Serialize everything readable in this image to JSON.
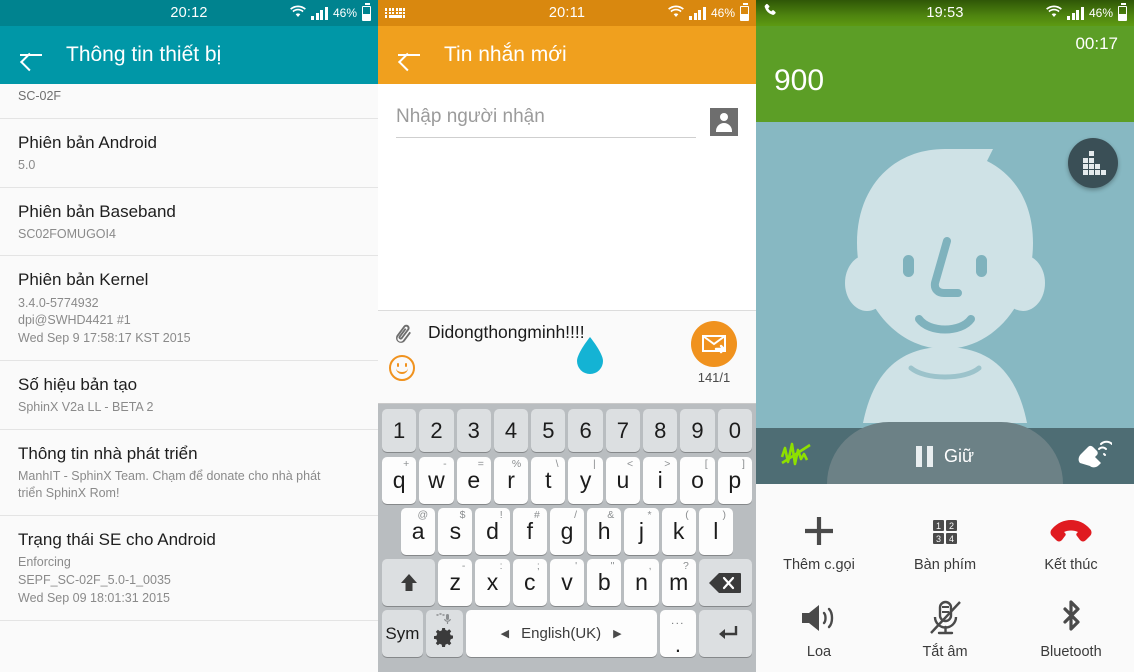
{
  "panel1": {
    "statusbar": {
      "time": "20:12",
      "battery_text": "46%",
      "wifi_icon": "wifi-icon",
      "signal_icon": "signal-bars-icon",
      "battery_icon": "battery-icon"
    },
    "appbar": {
      "back_icon": "back-arrow-icon",
      "title": "Thông tin thiết bị",
      "accent": "#0097a7"
    },
    "partial_row": {
      "value": "SC-02F"
    },
    "rows": [
      {
        "title": "Phiên bản Android",
        "sub": "5.0"
      },
      {
        "title": "Phiên bản Baseband",
        "sub": "SC02FOMUGOI4"
      },
      {
        "title": "Phiên bản Kernel",
        "sub": "3.4.0-5774932\ndpi@SWHD4421 #1\nWed Sep 9 17:58:17 KST 2015"
      },
      {
        "title": "Số hiệu bản tạo",
        "sub": "SphinX V2a LL - BETA 2"
      },
      {
        "title": "Thông tin nhà phát triển",
        "sub": "ManhIT - SphinX Team. Chạm để donate cho nhà phát\ntriển SphinX Rom!"
      },
      {
        "title": "Trạng thái SE cho Android",
        "sub": "Enforcing\nSEPF_SC-02F_5.0-1_0035\nWed Sep 09 18:01:31 2015"
      }
    ]
  },
  "panel2": {
    "statusbar": {
      "time": "20:11",
      "battery_text": "46%",
      "left_icon": "keyboard-icon"
    },
    "appbar": {
      "back_icon": "back-arrow-icon",
      "title": "Tin nhắn mới",
      "accent": "#f0a01e"
    },
    "recipient": {
      "placeholder": "Nhập người nhận",
      "value": "",
      "contact_icon": "contact-picker-icon"
    },
    "composer": {
      "attach_icon": "paperclip-icon",
      "message": "Didongthongminh!!!!",
      "emoji_icon": "smiley-icon",
      "sticker_icon": "water-drop-icon",
      "send_icon": "send-mms-icon",
      "counter": "141/1"
    },
    "keyboard": {
      "numbers": [
        "1",
        "2",
        "3",
        "4",
        "5",
        "6",
        "7",
        "8",
        "9",
        "0"
      ],
      "row1": [
        {
          "key": "q",
          "alt": "+"
        },
        {
          "key": "w",
          "alt": "-"
        },
        {
          "key": "e",
          "alt": "="
        },
        {
          "key": "r",
          "alt": "%"
        },
        {
          "key": "t",
          "alt": "\\"
        },
        {
          "key": "y",
          "alt": "|"
        },
        {
          "key": "u",
          "alt": "<"
        },
        {
          "key": "i",
          "alt": ">"
        },
        {
          "key": "o",
          "alt": "["
        },
        {
          "key": "p",
          "alt": "]"
        }
      ],
      "row2": [
        {
          "key": "a",
          "alt": "@"
        },
        {
          "key": "s",
          "alt": "$"
        },
        {
          "key": "d",
          "alt": "!"
        },
        {
          "key": "f",
          "alt": "#"
        },
        {
          "key": "g",
          "alt": "/"
        },
        {
          "key": "h",
          "alt": "&"
        },
        {
          "key": "j",
          "alt": "*"
        },
        {
          "key": "k",
          "alt": "("
        },
        {
          "key": "l",
          "alt": ")"
        }
      ],
      "row3": [
        {
          "key": "z",
          "alt": "-"
        },
        {
          "key": "x",
          "alt": ":"
        },
        {
          "key": "c",
          "alt": ";"
        },
        {
          "key": "v",
          "alt": "'"
        },
        {
          "key": "b",
          "alt": "\""
        },
        {
          "key": "n",
          "alt": ","
        },
        {
          "key": "m",
          "alt": "?"
        }
      ],
      "shift_icon": "shift-arrow-icon",
      "delete_icon": "backspace-icon",
      "sym_label": "Sym",
      "settings_icon": "gear-mic-icon",
      "space_label": "English(UK)",
      "space_prev_icon": "prev-language-icon",
      "space_next_icon": "next-language-icon",
      "period_label": ".",
      "period_alt": "...",
      "enter_icon": "enter-icon"
    }
  },
  "panel3": {
    "statusbar": {
      "time": "19:53",
      "battery_text": "46%",
      "left_icon": "phone-icon"
    },
    "header": {
      "duration": "00:17",
      "number": "900",
      "accent": "#5c9e26"
    },
    "avatar": {
      "icon": "default-contact-avatar",
      "eq_icon": "equalizer-icon"
    },
    "hold_bar": {
      "noise_icon": "noise-reduction-icon",
      "pause_icon": "pause-icon",
      "label": "Giữ",
      "extra_volume_icon": "extra-volume-icon"
    },
    "actions": [
      {
        "icon": "add-call-icon",
        "label": "Thêm c.gọi"
      },
      {
        "icon": "keypad-icon",
        "label": "Bàn phím"
      },
      {
        "icon": "end-call-icon",
        "label": "Kết thúc"
      },
      {
        "icon": "speaker-icon",
        "label": "Loa"
      },
      {
        "icon": "mute-icon",
        "label": "Tắt âm"
      },
      {
        "icon": "bluetooth-icon",
        "label": "Bluetooth"
      }
    ]
  }
}
